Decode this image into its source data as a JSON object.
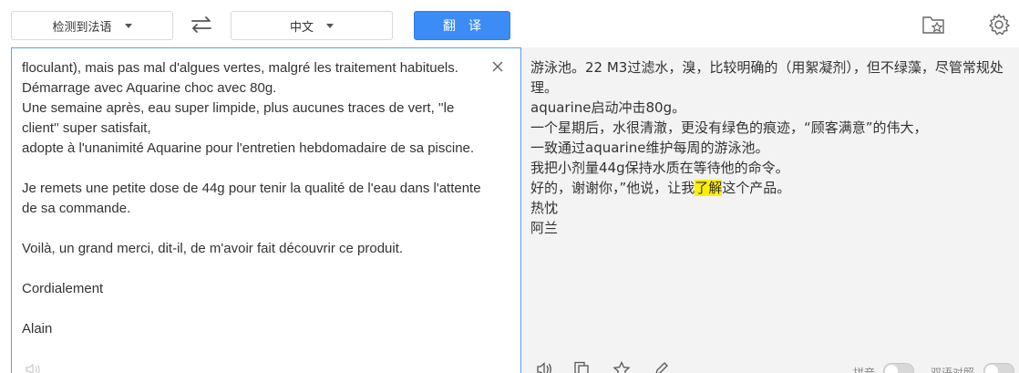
{
  "toolbar": {
    "source_lang": "检测到法语",
    "target_lang": "中文",
    "translate_label": "翻译"
  },
  "source": {
    "text": "floculant), mais pas mal d'algues vertes, malgré les traitement habituels.\nDémarrage avec Aquarine choc avec 80g.\nUne semaine après, eau super limpide, plus aucunes traces de vert, ''le client'' super satisfait,\nadopte à l'unanimité Aquarine pour l'entretien hebdomadaire de sa piscine.\n\nJe remets une petite dose de 44g pour tenir la qualité de l'eau dans l'attente de sa commande.\n\nVoilà, un grand merci, dit-il, de m'avoir fait découvrir ce produit.\n\nCordialement\n\nAlain"
  },
  "target": {
    "lines": [
      "游泳池。22 M3过滤水，溴，比较明确的（用絮凝剂），但不绿藻，尽管常规处理。",
      "aquarine启动冲击80g。",
      "一个星期后，水很清澈，更没有绿色的痕迹，“顾客满意”的伟大，",
      "一致通过aquarine维护每周的游泳池。",
      "我把小剂量44g保持水质在等待他的命令。"
    ],
    "line6_pre": "好的，谢谢你，”他说，让我",
    "line6_hl": "了解",
    "line6_post": "这个产品。",
    "line7": "热忱",
    "line8": "阿兰",
    "pinyin_label": "拼音",
    "bilingual_label": "双语对照"
  },
  "colors": {
    "accent": "#3b8cf5",
    "highlight": "#ffef00",
    "target_bg": "#f3f3f3"
  }
}
